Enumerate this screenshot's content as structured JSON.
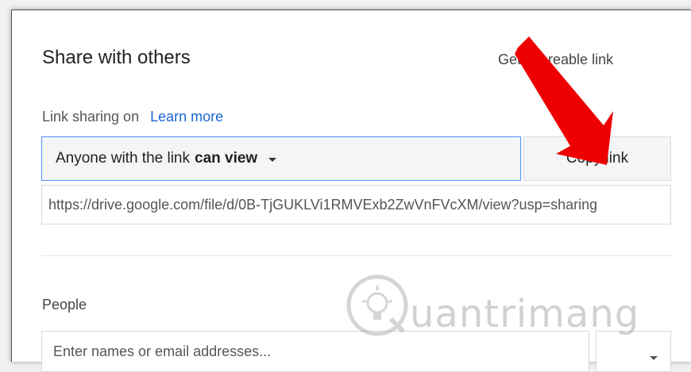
{
  "dialog": {
    "title": "Share with others",
    "shareable_link_label": "Get shareable link",
    "link_sharing_label": "Link sharing on",
    "learn_more": "Learn more",
    "access": {
      "prefix": "Anyone with the link",
      "level": "can view"
    },
    "copy_link": "Copy link",
    "url": "https://drive.google.com/file/d/0B-TjGUKLVi1RMVExb2ZwVnFVcXM/view?usp=sharing",
    "people_label": "People",
    "names_placeholder": "Enter names or email addresses..."
  },
  "watermark": {
    "text": "uantrimang"
  },
  "colors": {
    "link": "#1a66d2",
    "focus_border": "#4d90fe",
    "arrow": "#ee0000"
  }
}
